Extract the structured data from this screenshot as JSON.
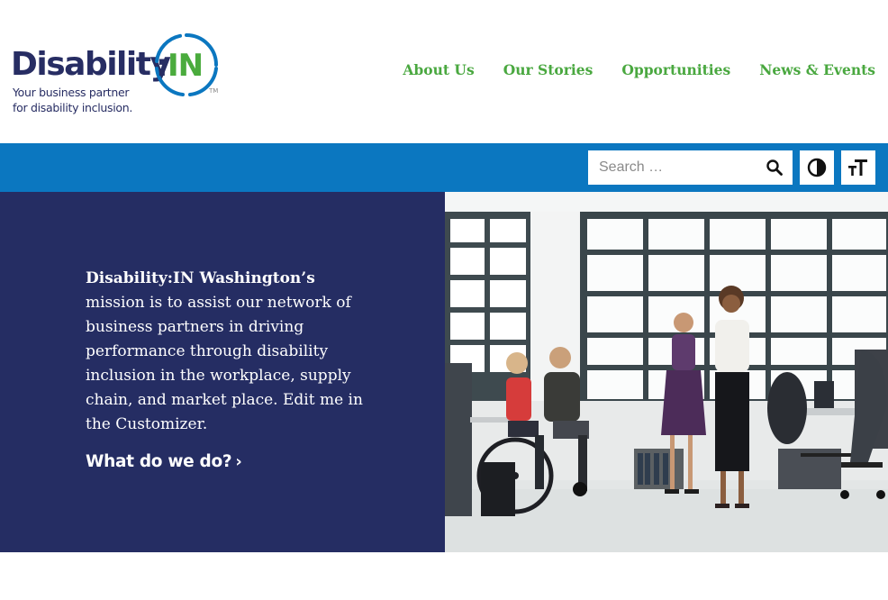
{
  "brand": {
    "wordmark": "Disability",
    "colon": ":",
    "in": "IN",
    "trademark": "TM",
    "tagline_line1": "Your business partner",
    "tagline_line2": "for disability inclusion.",
    "colors": {
      "navy": "#272d63",
      "green": "#4aab3d",
      "blue": "#0b77c0"
    }
  },
  "nav": {
    "items": [
      {
        "label": "About Us"
      },
      {
        "label": "Our Stories"
      },
      {
        "label": "Opportunities"
      },
      {
        "label": "News & Events"
      }
    ]
  },
  "toolbar": {
    "search_placeholder": "Search …",
    "search_icon": "search-icon",
    "contrast_icon": "contrast-icon",
    "text_size_icon": "text-size-icon"
  },
  "hero": {
    "mission_strong": "Disability:IN Washington’s",
    "mission_rest": "mission is to assist our network of business partners in driving performance through disability inclusion in the workplace, supply chain, and market place. Edit me in the Customizer.",
    "cta_label": "What do we do?",
    "cta_chevron": "›",
    "panel_color": "#252d63"
  }
}
